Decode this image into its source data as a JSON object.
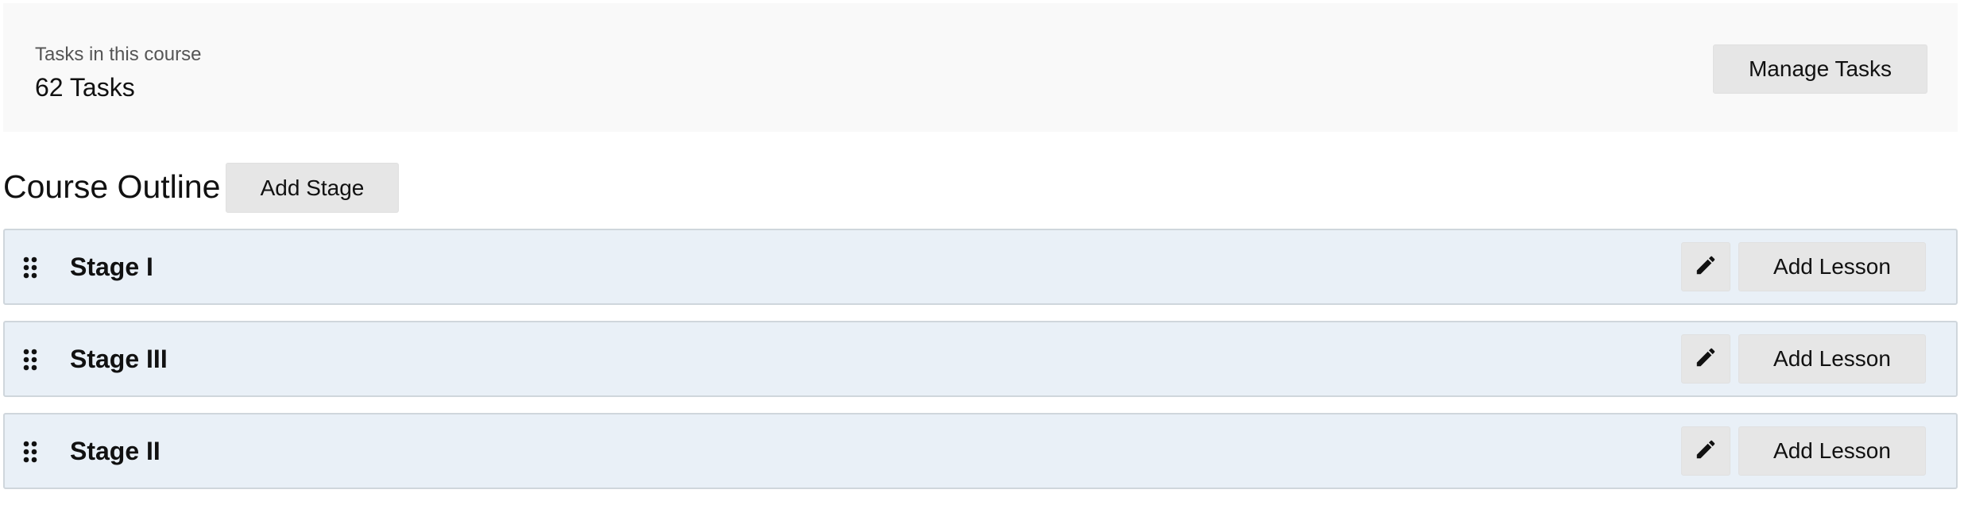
{
  "summary": {
    "label": "Tasks in this course",
    "count": "62 Tasks",
    "manage_label": "Manage Tasks"
  },
  "outline": {
    "title": "Course Outline",
    "add_stage_label": "Add Stage"
  },
  "stages": [
    {
      "name": "Stage I",
      "add_lesson_label": "Add Lesson",
      "edit_icon": "pencil-icon",
      "drag_icon": "drag-handle-icon"
    },
    {
      "name": "Stage III",
      "add_lesson_label": "Add Lesson",
      "edit_icon": "pencil-icon",
      "drag_icon": "drag-handle-icon"
    },
    {
      "name": "Stage II",
      "add_lesson_label": "Add Lesson",
      "edit_icon": "pencil-icon",
      "drag_icon": "drag-handle-icon"
    }
  ],
  "colors": {
    "summary_background": "#f9f9f9",
    "stage_background": "#e9f0f7",
    "stage_border": "#cfd6dc",
    "button_background": "#e6e6e6"
  }
}
